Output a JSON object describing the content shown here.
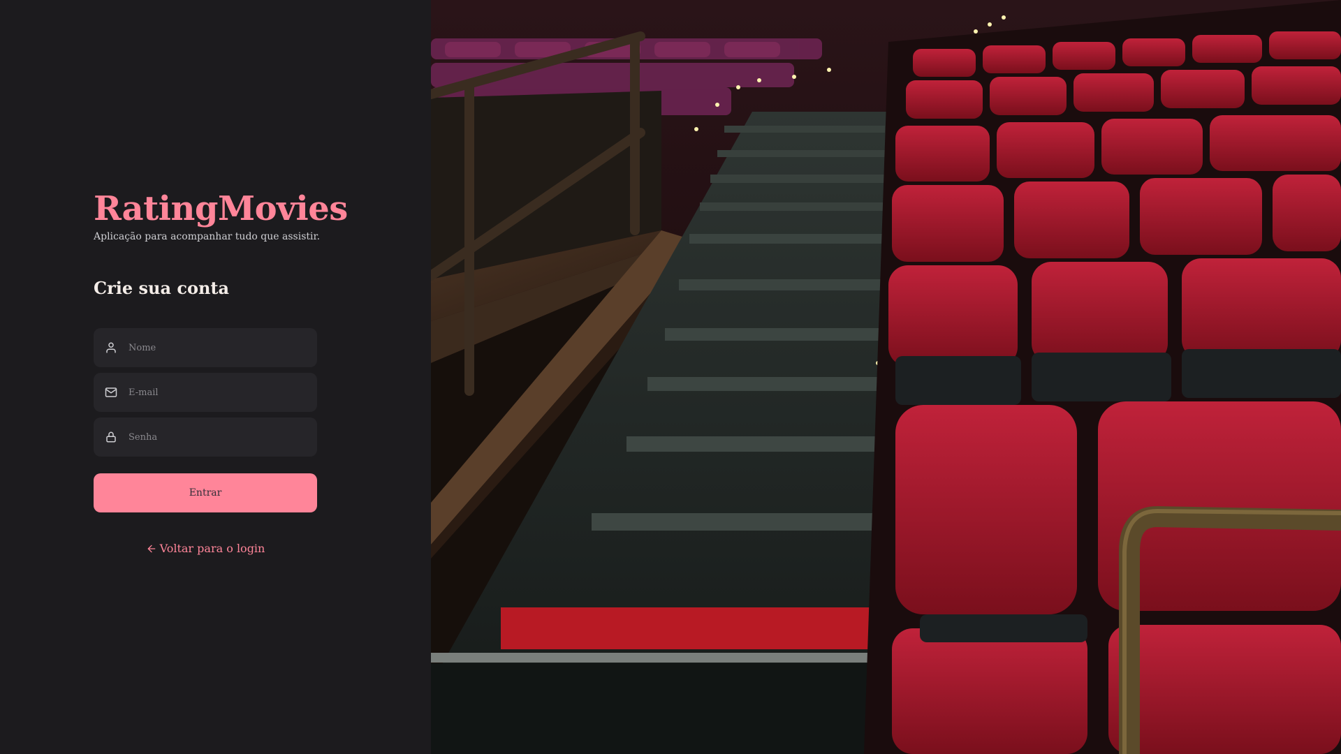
{
  "brand": {
    "title": "RatingMovies",
    "tagline": "Aplicação para acompanhar tudo que assistir."
  },
  "form": {
    "title": "Crie sua conta",
    "fields": {
      "name": {
        "placeholder": "Nome",
        "value": "",
        "icon": "user-icon"
      },
      "email": {
        "placeholder": "E-mail",
        "value": "",
        "icon": "mail-icon"
      },
      "password": {
        "placeholder": "Senha",
        "value": "",
        "icon": "lock-icon"
      }
    },
    "submit_label": "Entrar",
    "back_link_label": "Voltar para o login",
    "back_link_icon": "arrow-left-icon"
  },
  "background": {
    "description_icon": "cinema-background-image"
  },
  "colors": {
    "accent": "#ff8599",
    "panel": "#1c1b1e",
    "input": "#262529",
    "text_light": "#f4ede8",
    "placeholder": "#8a898e"
  }
}
